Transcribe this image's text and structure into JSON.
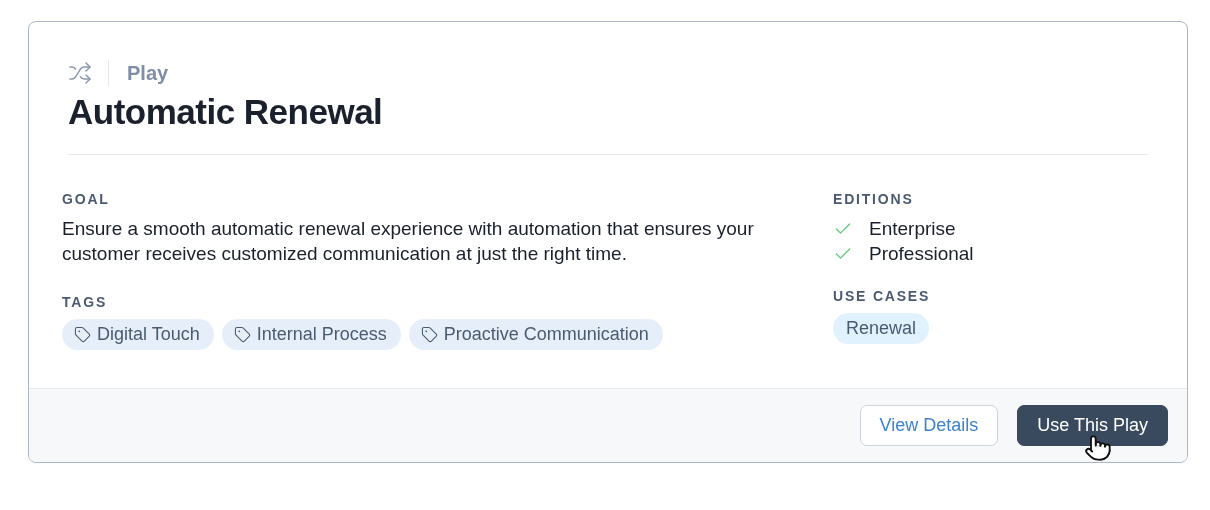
{
  "header": {
    "kind_label": "Play",
    "title": "Automatic Renewal"
  },
  "goal": {
    "label": "GOAL",
    "text": "Ensure a smooth automatic renewal experience with automation that ensures your customer receives customized communication at just the right time."
  },
  "tags": {
    "label": "TAGS",
    "items": [
      "Digital Touch",
      "Internal Process",
      "Proactive Communication"
    ]
  },
  "editions": {
    "label": "EDITIONS",
    "items": [
      {
        "name": "Enterprise",
        "checked": true
      },
      {
        "name": "Professional",
        "checked": true
      }
    ]
  },
  "use_cases": {
    "label": "USE CASES",
    "items": [
      "Renewal"
    ]
  },
  "buttons": [
    {
      "label": "View Details",
      "kind": "secondary"
    },
    {
      "label": "Use This Play",
      "kind": "primary"
    }
  ]
}
